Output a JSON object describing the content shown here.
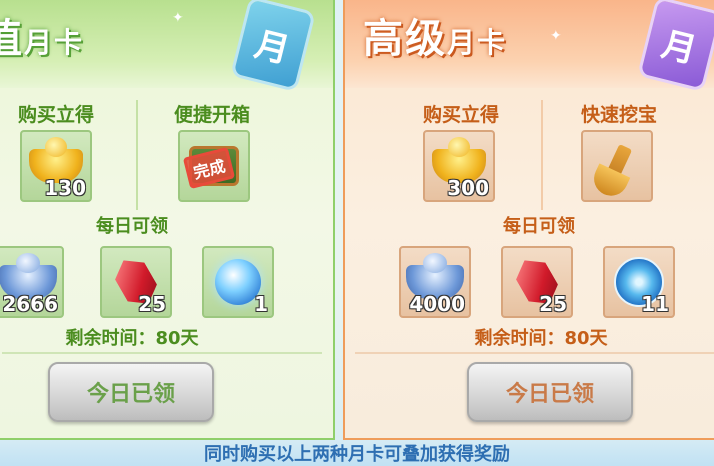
{
  "cards": [
    {
      "title_big": "值",
      "title_small": "月卡",
      "badge_char": "月",
      "left_section_label": "购买立得",
      "right_section_label": "便捷开箱",
      "purchase_reward_qty": "130",
      "right_item_stamp": "完成",
      "daily_label": "每日可领",
      "daily_items": [
        {
          "icon": "silver-ingot-icon",
          "qty": "2666"
        },
        {
          "icon": "red-gem-icon",
          "qty": "25"
        },
        {
          "icon": "crystal-orb-icon",
          "qty": "1"
        }
      ],
      "remaining_time": "剩余时间：80天",
      "claim_button": "今日已领"
    },
    {
      "title_big": "高级",
      "title_small": "月卡",
      "badge_char": "月",
      "left_section_label": "购买立得",
      "right_section_label": "快速挖宝",
      "purchase_reward_qty": "300",
      "daily_label": "每日可领",
      "daily_items": [
        {
          "icon": "silver-ingot-icon",
          "qty": "4000"
        },
        {
          "icon": "red-gem-icon",
          "qty": "25"
        },
        {
          "icon": "swirl-orb-icon",
          "qty": "11"
        }
      ],
      "remaining_time": "剩余时间：80天",
      "claim_button": "今日已领"
    }
  ],
  "footer_note": "同时购买以上两种月卡可叠加获得奖励",
  "colors": {
    "green_accent": "#4b8d1f",
    "orange_accent": "#c55e18",
    "footer_text": "#2e6fb2"
  }
}
